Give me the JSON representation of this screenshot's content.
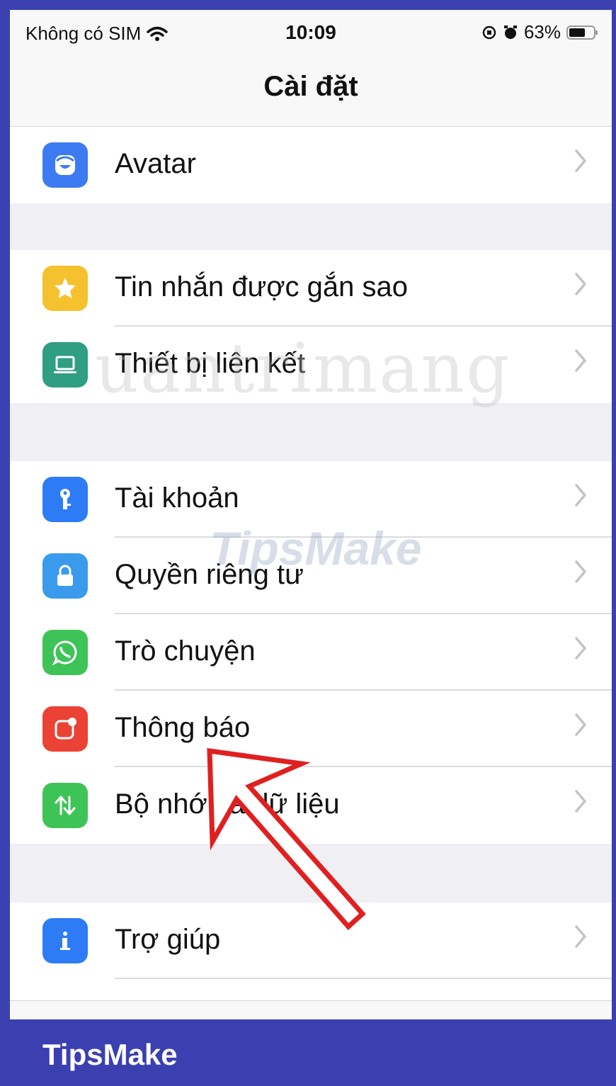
{
  "status_bar": {
    "carrier": "Không có SIM",
    "time": "10:09",
    "battery": "63%"
  },
  "nav": {
    "title": "Cài đặt"
  },
  "groups": [
    {
      "items": [
        {
          "label": "Avatar",
          "icon": "avatar-icon",
          "color": "#3d7bf2"
        }
      ]
    },
    {
      "items": [
        {
          "label": "Tin nhắn được gắn sao",
          "icon": "star-icon",
          "color": "#f5c12e"
        },
        {
          "label": "Thiết bị liên kết",
          "icon": "laptop-icon",
          "color": "#2f9e82"
        }
      ]
    },
    {
      "items": [
        {
          "label": "Tài khoản",
          "icon": "key-icon",
          "color": "#2d7cf6"
        },
        {
          "label": "Quyền riêng tư",
          "icon": "lock-icon",
          "color": "#3a9bec"
        },
        {
          "label": "Trò chuyện",
          "icon": "whatsapp-icon",
          "color": "#3ec357"
        },
        {
          "label": "Thông báo",
          "icon": "notification-icon",
          "color": "#ea4335"
        },
        {
          "label": "Bộ nhớ và dữ liệu",
          "icon": "data-transfer-icon",
          "color": "#3ec357"
        }
      ]
    },
    {
      "items": [
        {
          "label": "Trợ giúp",
          "icon": "info-icon",
          "color": "#2d7cf6"
        }
      ]
    }
  ],
  "watermarks": {
    "main": "uantrimang",
    "secondary": "TipsMake"
  },
  "brand": "TipsMake",
  "colors": {
    "frame": "#3b40b0",
    "annotation_arrow": "#e02020"
  }
}
